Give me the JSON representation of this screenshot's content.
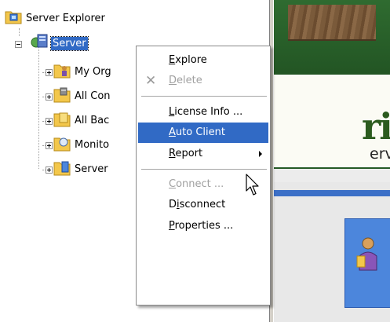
{
  "tree": {
    "root": {
      "label": "Server Explorer",
      "icon": "server-explorer-icon"
    },
    "server": {
      "label": "Server",
      "icon": "server-icon"
    },
    "children": [
      {
        "label": "My Org",
        "icon": "org-folder-icon"
      },
      {
        "label": "All Con",
        "icon": "computers-folder-icon"
      },
      {
        "label": "All Bac",
        "icon": "backup-folder-icon"
      },
      {
        "label": "Monito",
        "icon": "monitor-folder-icon"
      },
      {
        "label": "Server",
        "icon": "server-folder-icon"
      }
    ]
  },
  "context_menu": {
    "items": [
      {
        "label": "Explore",
        "mnemonic": "E",
        "state": "normal"
      },
      {
        "label": "Delete",
        "mnemonic": "D",
        "state": "disabled",
        "icon": "delete-x-icon"
      },
      {
        "label": "License Info ...",
        "mnemonic": "L",
        "state": "normal"
      },
      {
        "label": "Auto Client Installer ...",
        "mnemonic": "A",
        "state": "highlighted"
      },
      {
        "label": "Report",
        "mnemonic": "R",
        "state": "normal",
        "submenu": true
      },
      {
        "label": "Connect ...",
        "mnemonic": "C",
        "state": "disabled"
      },
      {
        "label": "Disconnect",
        "mnemonic": "i",
        "state": "normal"
      },
      {
        "label": "Properties ...",
        "mnemonic": "P",
        "state": "normal"
      }
    ]
  },
  "banner": {
    "big_text": "ri",
    "small_text": "erv"
  },
  "colors": {
    "selection": "#316ac5",
    "banner_green": "#2f6b30",
    "folder_yellow": "#f3c74b",
    "panel_blue": "#4c86dc"
  }
}
